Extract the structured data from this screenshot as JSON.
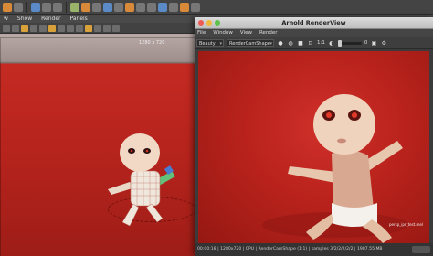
{
  "viewport": {
    "menu": [
      "w",
      "Show",
      "Render",
      "Panels"
    ],
    "resolution_label": "1280 x 720"
  },
  "renderview": {
    "title": "Arnold RenderView",
    "menu": [
      "File",
      "Window",
      "View",
      "Render"
    ],
    "aov_select": "Beauty",
    "camera_select": "RenderCamShape",
    "ratio_label": "1:1",
    "exposure_value": "0",
    "status": "00:00:18 | 1280x720 | CPU | RenderCamShape (1:1) | samples 3/2/2/2/2/2 | 1987.55 MB"
  },
  "overlay_text": "persp_ipr_test.mel",
  "colors": {
    "background_red": "#b9221c",
    "accent_orange": "#d8893a"
  }
}
